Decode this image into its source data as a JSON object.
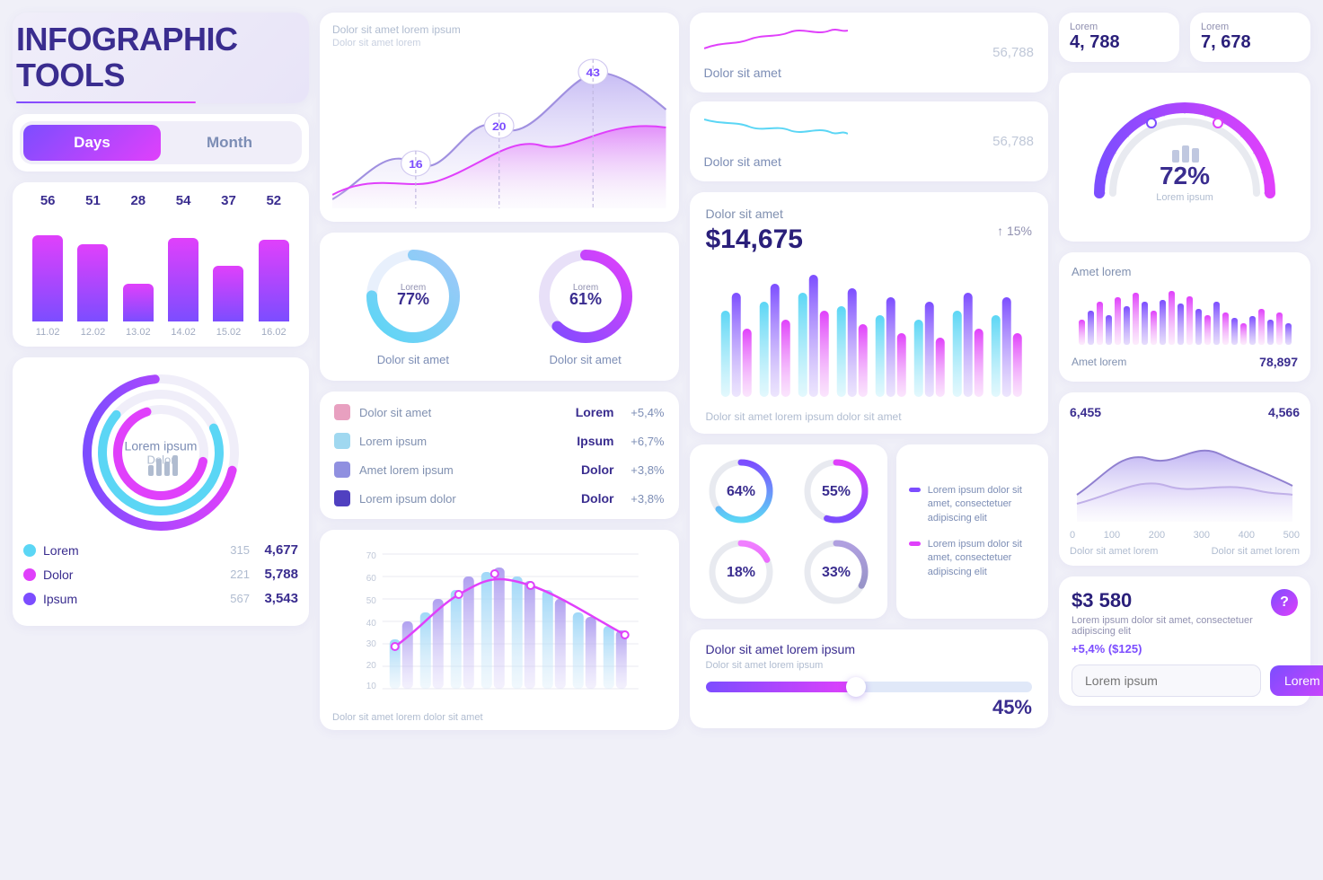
{
  "app": {
    "title_line1": "INFOGRAPHIC",
    "title_line2": "TOOLS"
  },
  "toggle": {
    "days_label": "Days",
    "month_label": "Month"
  },
  "bar_chart": {
    "values": [
      56,
      51,
      28,
      54,
      37,
      52
    ],
    "dates": [
      "11.02",
      "12.02",
      "13.02",
      "14.02",
      "15.02",
      "16.02"
    ],
    "heights_pct": [
      80,
      72,
      35,
      78,
      52,
      76
    ]
  },
  "donut_chart": {
    "label_main": "Lorem ipsum",
    "label_sub": "Dolor"
  },
  "legend": {
    "items": [
      {
        "color": "#5bd6f5",
        "label": "Lorem",
        "mid": "315",
        "val": "4,677"
      },
      {
        "color": "#e040fb",
        "label": "Dolor",
        "mid": "221",
        "val": "5,788"
      },
      {
        "color": "#7c4dff",
        "label": "Ipsum",
        "mid": "567",
        "val": "3,543"
      }
    ]
  },
  "area_chart_top": {
    "title": "Dolor sit amet lorem ipsum",
    "sub": "Dolor sit amet lorem",
    "data_points": [
      16,
      20,
      43
    ],
    "labels": [
      "16",
      "20",
      "43"
    ]
  },
  "pie_charts": [
    {
      "pct": 77,
      "label": "Dolor sit amet",
      "color1": "#5bd6f5",
      "color2": "#e8eaf6"
    },
    {
      "pct": 61,
      "label": "Dolor sit amet",
      "color1": "#7c4dff",
      "color2": "#e040fb"
    }
  ],
  "pie_labels": {
    "lorem_label": "Lorem",
    "ipsum_label": "Ipsum"
  },
  "stats_list": {
    "items": [
      {
        "color": "#e8a0c0",
        "text": "Dolor sit amet",
        "name": "Lorem",
        "pct": "+5,4%"
      },
      {
        "color": "#a0d8f0",
        "text": "Lorem ipsum",
        "name": "Ipsum",
        "pct": "+6,7%"
      },
      {
        "color": "#9090e0",
        "text": "Amet lorem ipsum",
        "name": "Dolor",
        "pct": "+3,8%"
      },
      {
        "color": "#5040c0",
        "text": "Lorem ipsum dolor",
        "name": "Dolor",
        "pct": "+3,8%"
      }
    ]
  },
  "bar_line_chart": {
    "y_labels": [
      "10",
      "20",
      "30",
      "40",
      "50",
      "60",
      "70"
    ],
    "footer": "Dolor sit amet lorem dolor sit amet"
  },
  "line_charts": {
    "items": [
      {
        "label": "Dolor sit amet",
        "val": "56,788"
      },
      {
        "label": "Dolor sit amet",
        "val": "56,788"
      }
    ]
  },
  "big_stat": {
    "label": "Dolor sit amet",
    "value": "$14,675",
    "pct": "↑ 15%"
  },
  "grouped_bars": {
    "label": "Dolor sit amet lorem ipsum dolor sit amet"
  },
  "circle_stats": [
    {
      "pct": "64%"
    },
    {
      "pct": "55%"
    },
    {
      "pct": "18%"
    },
    {
      "pct": "33%"
    }
  ],
  "circle_legends": [
    {
      "color": "#7c4dff",
      "text": "Lorem ipsum dolor sit amet, consectetuer adipiscing elit"
    },
    {
      "color": "#e040fb",
      "text": "Lorem ipsum dolor sit amet, consectetuer adipiscing elit"
    }
  ],
  "slider": {
    "label": "Dolor sit amet lorem ipsum",
    "sub": "Dolor sit amet lorem ipsum",
    "pct": "45%"
  },
  "top_stats": [
    {
      "label": "Lorem",
      "val": "4, 788"
    },
    {
      "label": "Lorem",
      "val": "7, 678"
    }
  ],
  "gauge": {
    "pct": "72%",
    "sub": "Lorem ipsum"
  },
  "mini_bar_chart": {
    "label": "Amet lorem",
    "val": "78,897"
  },
  "area_chart_right": {
    "nums": [
      "6,455",
      "4,566"
    ],
    "axis_labels": [
      "0",
      "100",
      "200",
      "300",
      "400",
      "500"
    ],
    "footer_left": "Dolor sit amet lorem",
    "footer_right": "Dolor sit amet lorem"
  },
  "price_card": {
    "val": "$3 580",
    "desc": "Lorem ipsum dolor sit amet, consectetuer adipiscing elit",
    "pct": "+5,4% ($125)",
    "input_placeholder": "Lorem ipsum",
    "btn_label": "Lorem →"
  }
}
